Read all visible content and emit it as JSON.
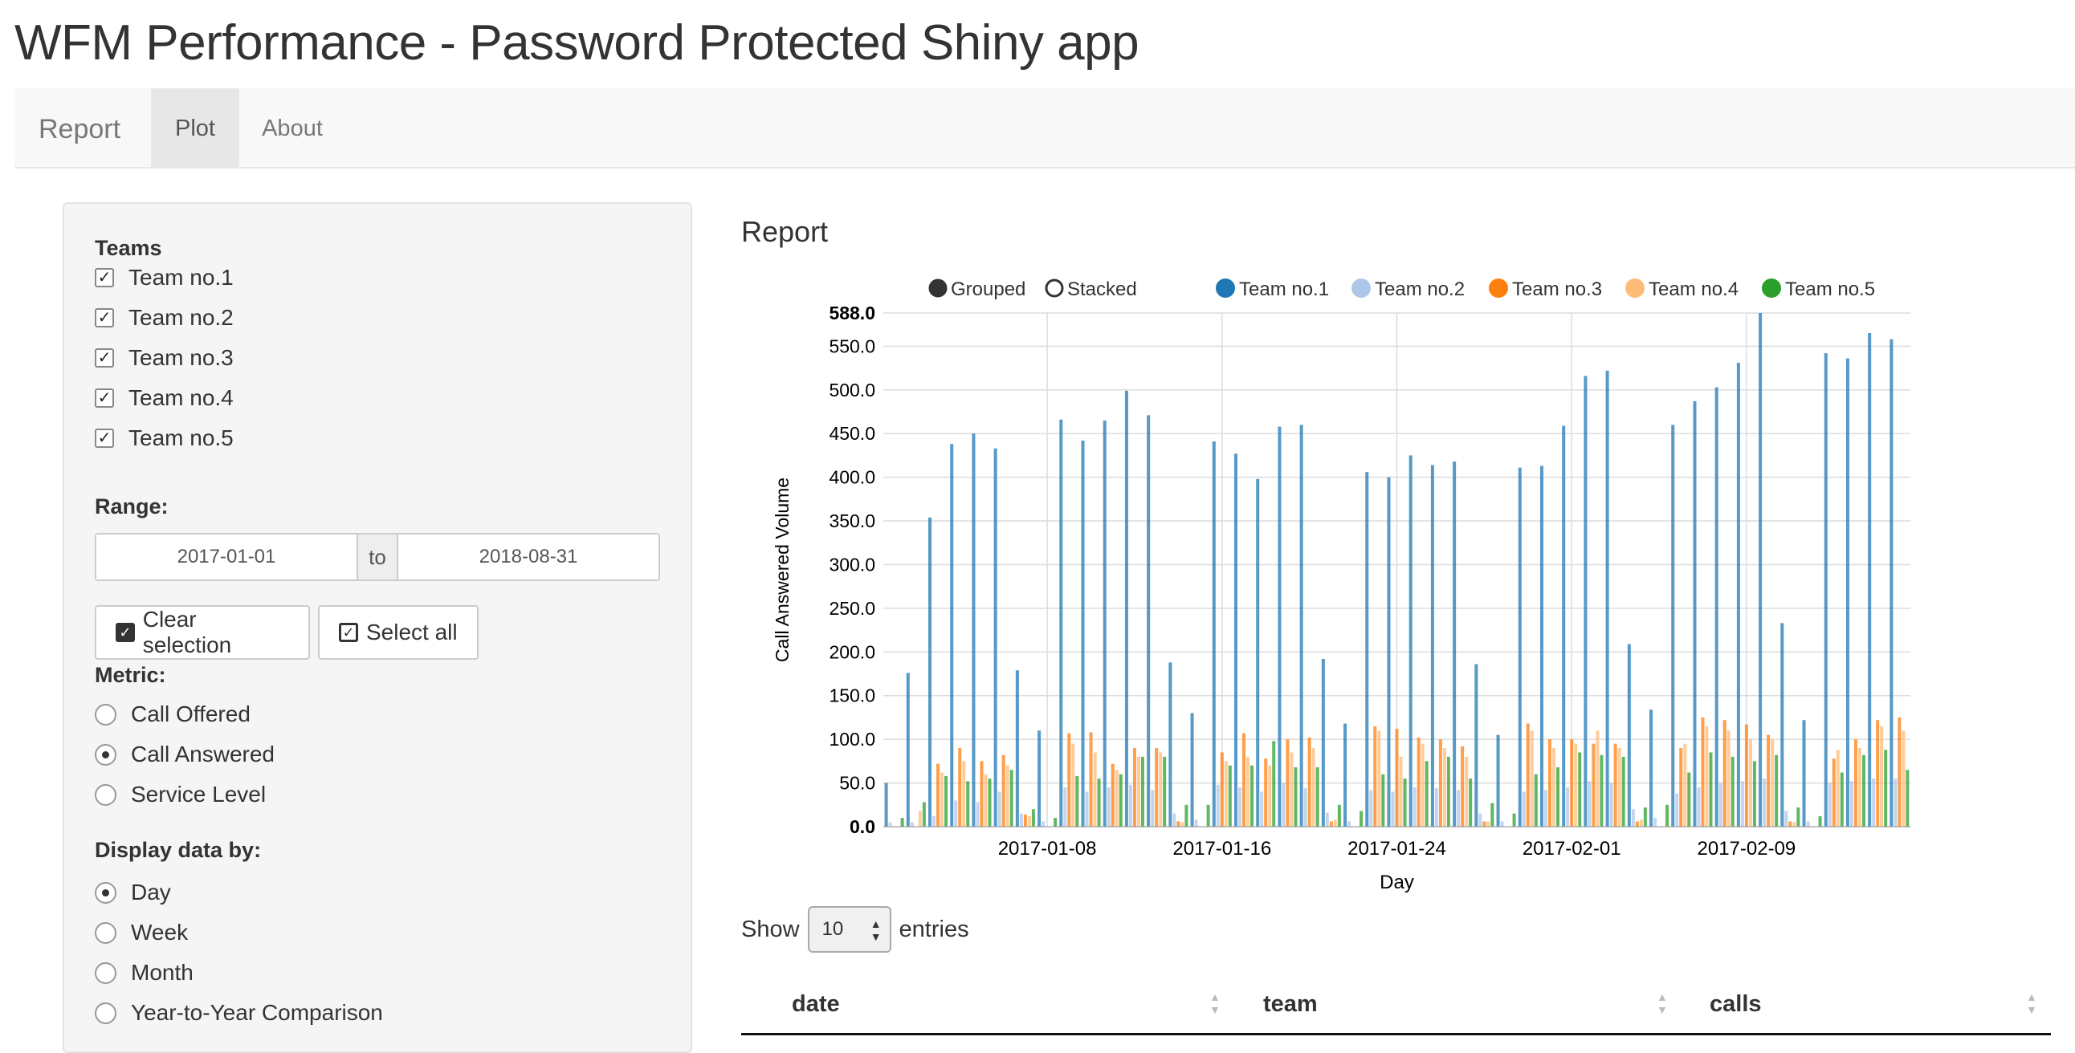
{
  "app": {
    "title": "WFM Performance - Password Protected Shiny app"
  },
  "navbar": {
    "brand": "Report",
    "tabs": [
      {
        "label": "Plot",
        "active": true
      },
      {
        "label": "About",
        "active": false
      }
    ]
  },
  "sidebar": {
    "teams_label": "Teams",
    "teams": [
      {
        "label": "Team no.1",
        "checked": true
      },
      {
        "label": "Team no.2",
        "checked": true
      },
      {
        "label": "Team no.3",
        "checked": true
      },
      {
        "label": "Team no.4",
        "checked": true
      },
      {
        "label": "Team no.5",
        "checked": true
      }
    ],
    "range_label": "Range:",
    "range_start": "2017-01-01",
    "range_sep": "to",
    "range_end": "2018-08-31",
    "clear_label": "Clear selection",
    "select_all_label": "Select all",
    "metric_label": "Metric:",
    "metrics": [
      {
        "label": "Call Offered",
        "selected": false
      },
      {
        "label": "Call Answered",
        "selected": true
      },
      {
        "label": "Service Level",
        "selected": false
      }
    ],
    "display_label": "Display data by:",
    "display_options": [
      {
        "label": "Day",
        "selected": true
      },
      {
        "label": "Week",
        "selected": false
      },
      {
        "label": "Month",
        "selected": false
      },
      {
        "label": "Year-to-Year Comparison",
        "selected": false
      }
    ]
  },
  "main": {
    "report_title": "Report",
    "show_label": "Show",
    "page_size": "10",
    "entries_label": "entries",
    "table_columns": [
      "date",
      "team",
      "calls"
    ]
  },
  "chart_data": {
    "type": "bar",
    "mode": "grouped",
    "controls": [
      "Grouped",
      "Stacked"
    ],
    "ylabel": "Call Answered Volume",
    "xlabel": "Day",
    "ylim": [
      0,
      588
    ],
    "y_ticks": [
      "0.0",
      "50.0",
      "100.0",
      "150.0",
      "200.0",
      "250.0",
      "300.0",
      "350.0",
      "400.0",
      "450.0",
      "500.0",
      "550.0",
      "588.0"
    ],
    "x_ticks": [
      "2017-01-08",
      "2017-01-16",
      "2017-01-24",
      "2017-02-01",
      "2017-02-09"
    ],
    "x_tick_days": [
      7,
      15,
      23,
      31,
      39
    ],
    "grid": true,
    "legend_position": "top",
    "categories": [
      "2017-01-01",
      "2017-01-02",
      "2017-01-03",
      "2017-01-04",
      "2017-01-05",
      "2017-01-06",
      "2017-01-07",
      "2017-01-08",
      "2017-01-09",
      "2017-01-10",
      "2017-01-11",
      "2017-01-12",
      "2017-01-13",
      "2017-01-14",
      "2017-01-15",
      "2017-01-16",
      "2017-01-17",
      "2017-01-18",
      "2017-01-19",
      "2017-01-20",
      "2017-01-21",
      "2017-01-22",
      "2017-01-23",
      "2017-01-24",
      "2017-01-25",
      "2017-01-26",
      "2017-01-27",
      "2017-01-28",
      "2017-01-29",
      "2017-01-30",
      "2017-01-31",
      "2017-02-01",
      "2017-02-02",
      "2017-02-03",
      "2017-02-04",
      "2017-02-05",
      "2017-02-06",
      "2017-02-07",
      "2017-02-08",
      "2017-02-09",
      "2017-02-10",
      "2017-02-11",
      "2017-02-12",
      "2017-02-13",
      "2017-02-14",
      "2017-02-15",
      "2017-02-16"
    ],
    "series": [
      {
        "name": "Team no.1",
        "color": "#1f77b4",
        "values": [
          50,
          176,
          354,
          438,
          450,
          433,
          179,
          110,
          466,
          442,
          465,
          499,
          471,
          188,
          130,
          441,
          427,
          398,
          458,
          460,
          192,
          118,
          406,
          400,
          425,
          414,
          418,
          186,
          105,
          411,
          413,
          459,
          516,
          522,
          209,
          134,
          460,
          487,
          503,
          531,
          588,
          233,
          122,
          542,
          536,
          565,
          558
        ]
      },
      {
        "name": "Team no.2",
        "color": "#aec7e8",
        "values": [
          5,
          5,
          12,
          30,
          28,
          40,
          15,
          6,
          45,
          40,
          45,
          48,
          42,
          15,
          8,
          48,
          45,
          40,
          50,
          44,
          16,
          6,
          42,
          40,
          45,
          44,
          42,
          15,
          6,
          40,
          42,
          45,
          52,
          50,
          20,
          10,
          38,
          45,
          50,
          52,
          55,
          18,
          6,
          50,
          52,
          55,
          55
        ]
      },
      {
        "name": "Team no.3",
        "color": "#ff7f0e",
        "values": [
          0,
          0,
          72,
          90,
          75,
          82,
          14,
          0,
          107,
          108,
          72,
          90,
          90,
          6,
          0,
          85,
          107,
          78,
          100,
          102,
          6,
          0,
          115,
          112,
          102,
          100,
          92,
          6,
          0,
          118,
          100,
          100,
          95,
          95,
          6,
          0,
          90,
          125,
          122,
          117,
          105,
          6,
          0,
          78,
          100,
          122,
          125
        ]
      },
      {
        "name": "Team no.4",
        "color": "#ffbb78",
        "values": [
          0,
          18,
          62,
          75,
          60,
          70,
          12,
          0,
          95,
          85,
          65,
          80,
          85,
          5,
          0,
          75,
          80,
          70,
          85,
          90,
          8,
          0,
          110,
          80,
          95,
          90,
          80,
          6,
          0,
          110,
          90,
          95,
          110,
          90,
          8,
          0,
          95,
          115,
          110,
          100,
          100,
          5,
          0,
          88,
          90,
          115,
          110
        ]
      },
      {
        "name": "Team no.5",
        "color": "#2ca02c",
        "values": [
          10,
          28,
          58,
          52,
          55,
          65,
          20,
          10,
          58,
          55,
          60,
          80,
          80,
          25,
          25,
          70,
          70,
          98,
          68,
          68,
          25,
          18,
          60,
          55,
          75,
          80,
          55,
          27,
          15,
          60,
          68,
          85,
          82,
          80,
          22,
          25,
          62,
          85,
          80,
          75,
          82,
          22,
          12,
          62,
          82,
          88,
          65
        ]
      }
    ]
  }
}
